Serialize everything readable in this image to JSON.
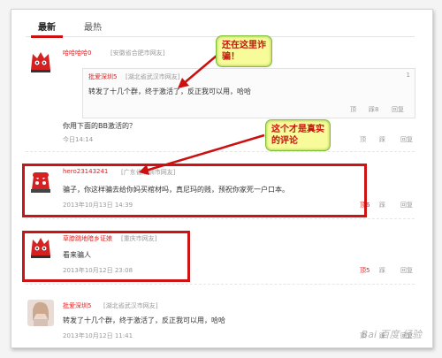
{
  "tabs": [
    "最新",
    "最热"
  ],
  "comments": [
    {
      "user": "哈哈哈哈0",
      "location": "[安徽省合肥市网友]",
      "text": "你用下面的BB激活的？",
      "time": "今日14:14",
      "actions": [
        "顶",
        "踩",
        "回复"
      ]
    },
    {
      "user": "hero23143241",
      "location": "[广东省深圳市网友]",
      "text": "骗子，你这样骗去给你妈买棺材吗，真尼玛的贱，预祝你家死一户口本。",
      "time": "2013年10月13日 14:39",
      "actions": [
        "顶6",
        "踩",
        "回复"
      ]
    },
    {
      "user": "草脖跳地暗乡证娘",
      "location": "[重庆市网友]",
      "text": "看来骗人",
      "time": "2013年10月12日 23:08",
      "actions": [
        "顶5",
        "踩",
        "回复"
      ]
    },
    {
      "user": "批爱深圳5",
      "location": "[湖北省武汉市网友]",
      "text": "转发了十几个群，终于激活了，反正我可以用，哈哈",
      "time": "2013年10月12日 11:41",
      "actions": [
        "顶",
        "踩",
        "回复"
      ]
    }
  ],
  "quote": {
    "user": "批爱深圳5",
    "location": "[湖北省武汉市网友]",
    "text": "转发了十几个群，终于激活了，反正我可以用，哈哈",
    "floor": "1",
    "actions": [
      "顶",
      "踩8",
      "回复"
    ]
  },
  "callouts": {
    "top": "还在这里诈\n骗！",
    "mid": "这个才是真实\n的评论"
  },
  "watermark": "Bai 百度 经验"
}
